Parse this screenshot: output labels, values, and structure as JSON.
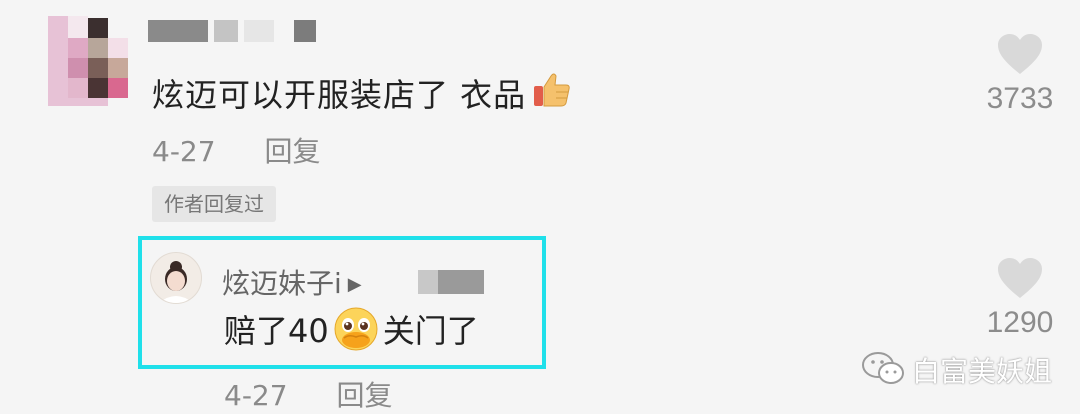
{
  "comment": {
    "text": "炫迈可以开服装店了 衣品",
    "date": "4-27",
    "reply_label": "回复",
    "author_tag": "作者回复过",
    "likes": "3733"
  },
  "reply": {
    "username": "炫迈妹子i",
    "text_before": "赔了40",
    "text_after": "关门了",
    "date": "4-27",
    "reply_label": "回复",
    "likes": "1290"
  },
  "watermark": {
    "text": "白富美妖姐"
  },
  "colors": {
    "highlight_border": "#1fe0ea",
    "meta_gray": "#8a8a8a",
    "heart_gray": "#d9d9d9"
  },
  "icons": [
    "thumbs-up-emoji",
    "heart-icon",
    "play-arrow-icon",
    "pleading-face-emoji",
    "wechat-icon"
  ]
}
